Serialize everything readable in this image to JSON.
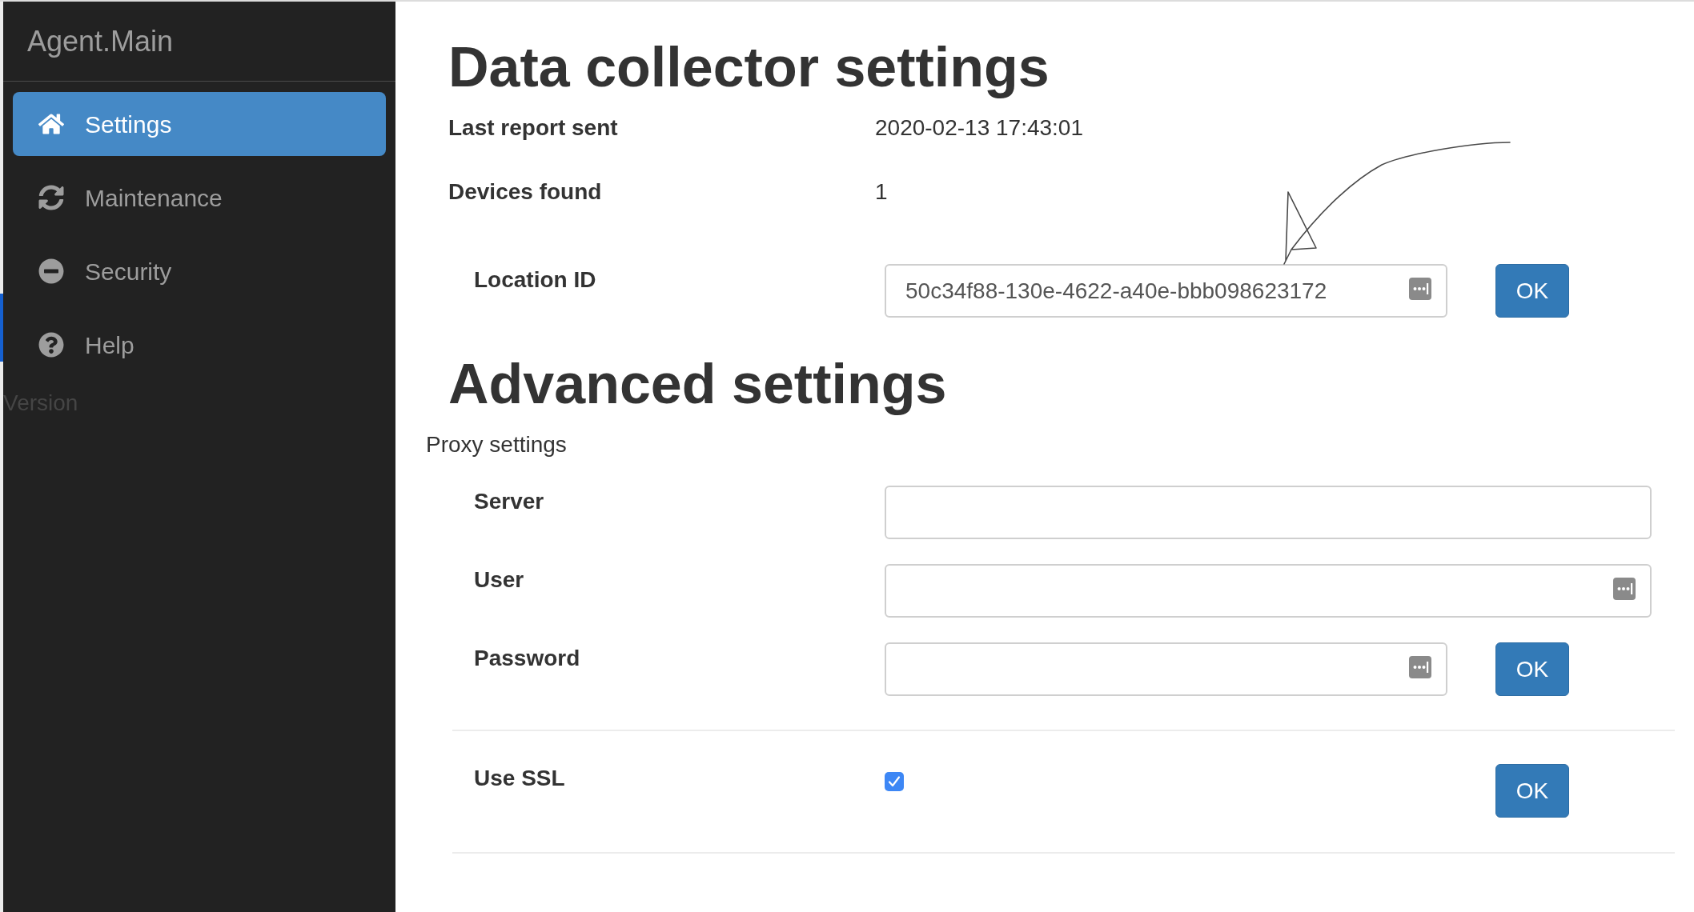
{
  "sidebar": {
    "brand": "Agent.Main",
    "items": [
      {
        "label": "Settings",
        "selected": true
      },
      {
        "label": "Maintenance",
        "selected": false
      },
      {
        "label": "Security",
        "selected": false
      },
      {
        "label": "Help",
        "selected": false
      }
    ],
    "version_label": "Version"
  },
  "data_collector": {
    "title": "Data collector settings",
    "info": [
      {
        "label": "Last report sent",
        "value": "2020-02-13 17:43:01"
      },
      {
        "label": "Devices found",
        "value": "1"
      }
    ],
    "location": {
      "label": "Location ID",
      "value": "50c34f88-130e-4622-a40e-bbb098623172",
      "autofill_icon": true,
      "button": "OK"
    }
  },
  "advanced": {
    "title": "Advanced settings",
    "subtitle": "Proxy settings",
    "fields": [
      {
        "label": "Server",
        "autofill_icon": false
      },
      {
        "label": "User",
        "autofill_icon": true
      },
      {
        "label": "Password",
        "autofill_icon": true,
        "button": "OK"
      }
    ],
    "ssl": {
      "label": "Use SSL",
      "checked": true,
      "button": "OK"
    }
  }
}
